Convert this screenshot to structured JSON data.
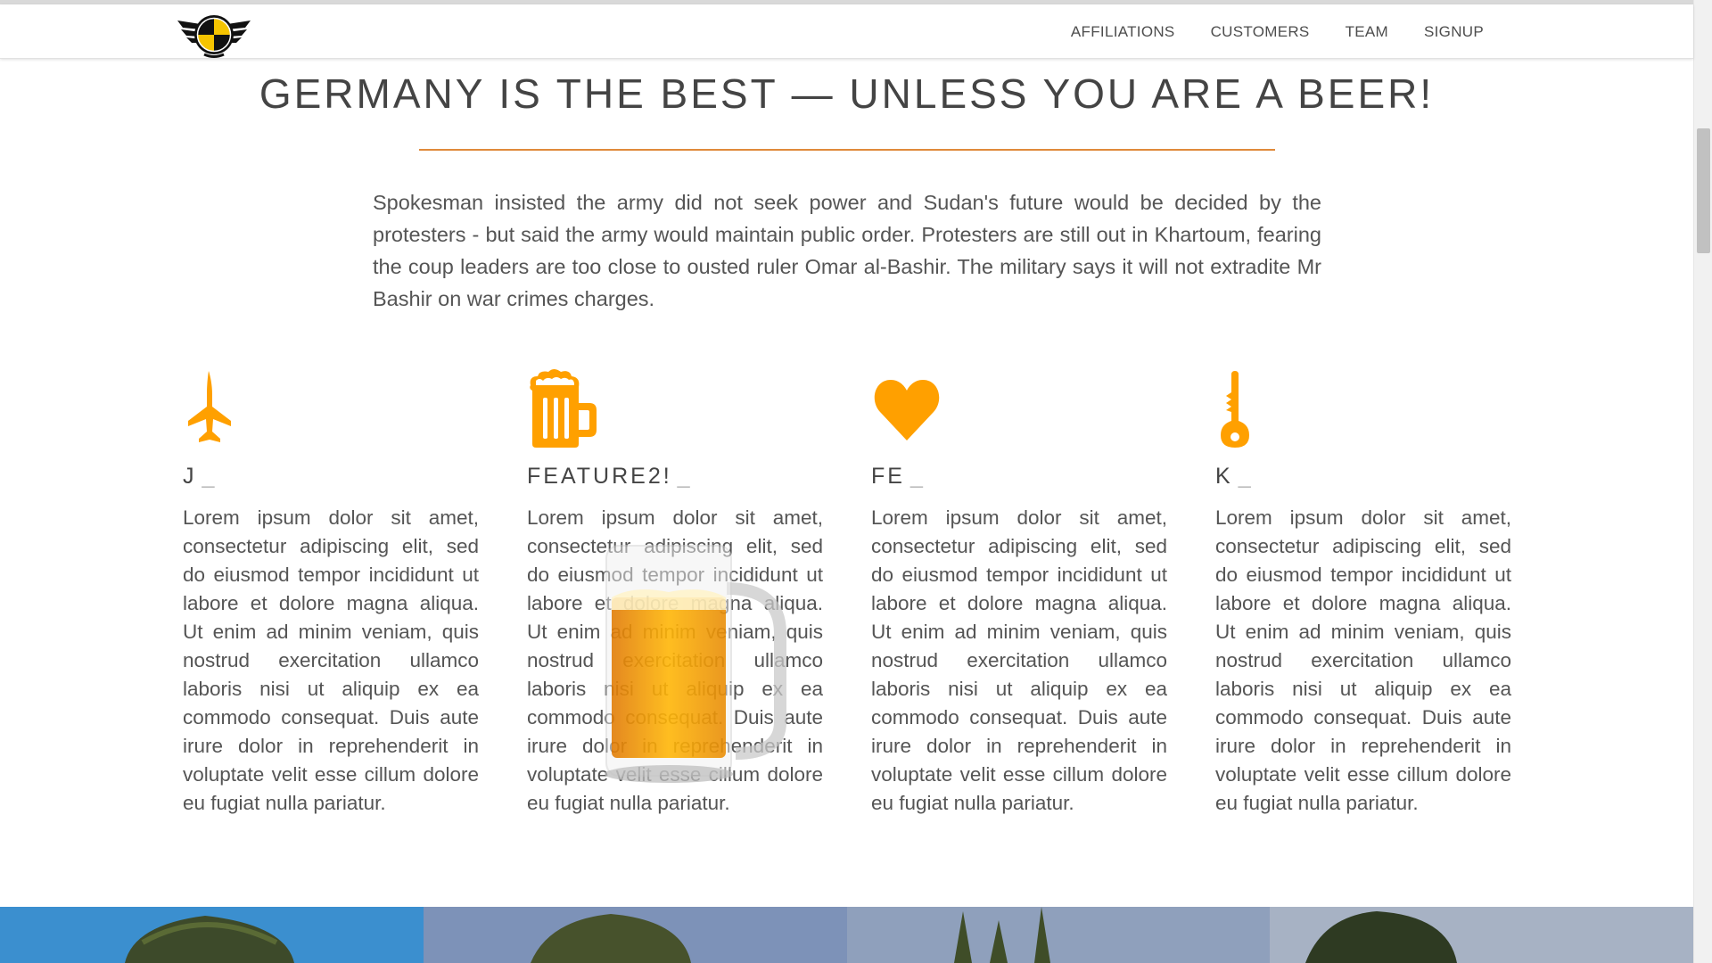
{
  "nav": {
    "links": [
      "AFFILIATIONS",
      "CUSTOMERS",
      "TEAM",
      "SIGNUP"
    ]
  },
  "hero": {
    "title": "GERMANY IS THE BEST — UNLESS YOU ARE A BEER!",
    "intro": "Spokesman insisted the army did not seek power and Sudan's future would be decided by the protesters - but said the army would maintain public order. Protesters are still out in Khartoum, fearing the coup leaders are too close to ousted ruler Omar al-Bashir. The military says it will not extradite Mr Bashir on war crimes charges."
  },
  "features": [
    {
      "icon": "jet-icon",
      "title": "J",
      "cursor": "_",
      "body": "Lorem ipsum dolor sit amet, consectetur adipiscing elit, sed do eiusmod tempor incididunt ut labore et dolore magna aliqua. Ut enim ad minim veniam, quis nostrud exercitation ullamco laboris nisi ut aliquip ex ea commodo consequat. Duis aute irure dolor in reprehenderit in voluptate velit esse cillum dolore eu fugiat nulla pariatur."
    },
    {
      "icon": "beer-icon",
      "title": "FEATURE2!",
      "cursor": "_",
      "body": "Lorem ipsum dolor sit amet, consectetur adipiscing elit, sed do eiusmod tempor incididunt ut labore et dolore magna aliqua. Ut enim ad minim veniam, quis nostrud exercitation ullamco laboris nisi ut aliquip ex ea commodo consequat. Duis aute irure dolor in reprehenderit in voluptate velit esse cillum dolore eu fugiat nulla pariatur."
    },
    {
      "icon": "heart-icon",
      "title": "FE",
      "cursor": "_",
      "body": "Lorem ipsum dolor sit amet, consectetur adipiscing elit, sed do eiusmod tempor incididunt ut labore et dolore magna aliqua. Ut enim ad minim veniam, quis nostrud exercitation ullamco laboris nisi ut aliquip ex ea commodo consequat. Duis aute irure dolor in reprehenderit in voluptate velit esse cillum dolore eu fugiat nulla pariatur."
    },
    {
      "icon": "key-icon",
      "title": "K",
      "cursor": "_",
      "body": "Lorem ipsum dolor sit amet, consectetur adipiscing elit, sed do eiusmod tempor incididunt ut labore et dolore magna aliqua. Ut enim ad minim veniam, quis nostrud exercitation ullamco laboris nisi ut aliquip ex ea commodo consequat. Duis aute irure dolor in reprehenderit in voluptate velit esse cillum dolore eu fugiat nulla pariatur."
    }
  ],
  "colors": {
    "accent": "#ffa000",
    "rule": "#e08a3a",
    "text": "#555555",
    "heading": "#444444"
  },
  "gallery": [
    "dragon-tree-photo",
    "dragon-tree-photo",
    "cactus-photo",
    "cactus-photo"
  ]
}
